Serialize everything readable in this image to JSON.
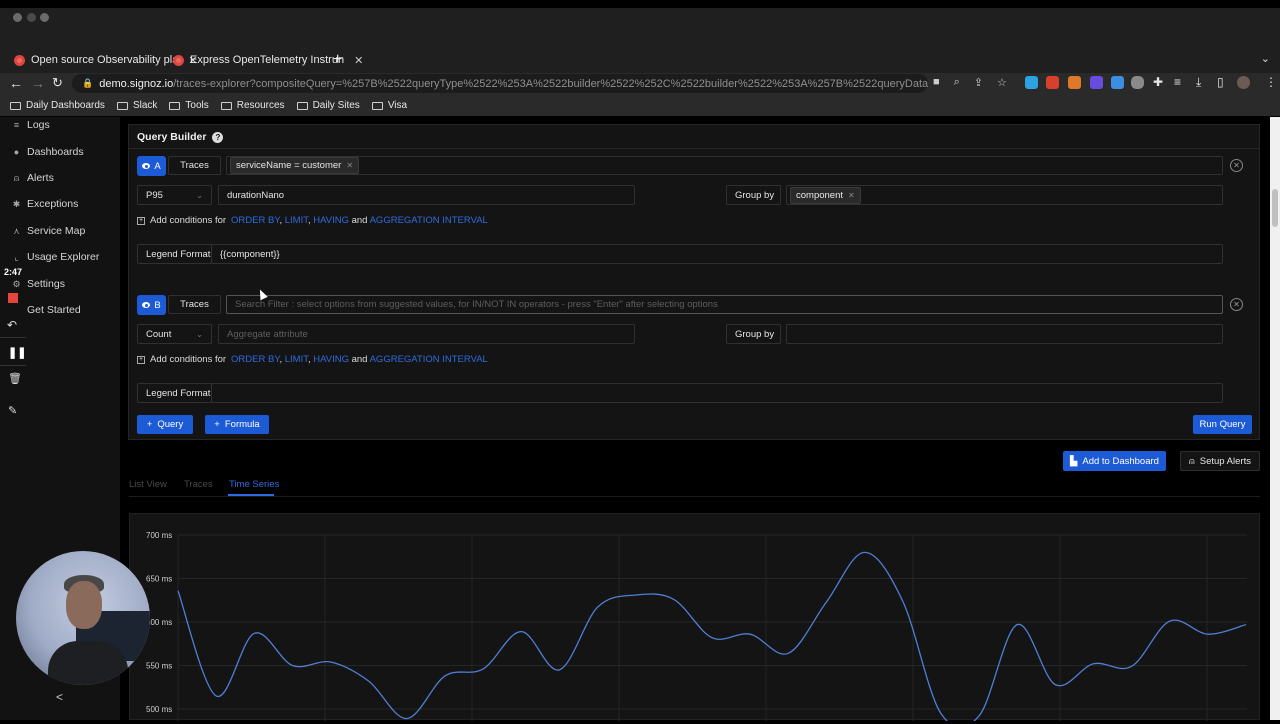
{
  "browser": {
    "tabs": [
      {
        "title": "Open source Observability pla",
        "active": true
      },
      {
        "title": "Express OpenTelemetry Instrun",
        "active": false
      }
    ],
    "new_tab": "+",
    "address": {
      "host": "demo.signoz.io",
      "path": "/traces-explorer?compositeQuery=%257B%2522queryType%2522%253A%2522builder%2522%252C%2522builder%2522%253A%257B%2522queryData%2522%253A%..."
    },
    "bookmarks": [
      "Daily Dashboards",
      "Slack",
      "Tools",
      "Resources",
      "Daily Sites",
      "Visa"
    ]
  },
  "sidebar": {
    "items": [
      {
        "label": "Logs",
        "icon": "logs-icon"
      },
      {
        "label": "Dashboards",
        "icon": "dashboard-icon"
      },
      {
        "label": "Alerts",
        "icon": "alert-icon"
      },
      {
        "label": "Exceptions",
        "icon": "bug-icon"
      },
      {
        "label": "Service Map",
        "icon": "service-map-icon"
      },
      {
        "label": "Usage Explorer",
        "icon": "chart-icon"
      },
      {
        "label": "Settings",
        "icon": "settings-icon"
      },
      {
        "label": "Get Started",
        "icon": "rocket-icon"
      }
    ],
    "recording_timer": "2:47",
    "collapse": "<"
  },
  "query_builder": {
    "title": "Query Builder",
    "help": "?",
    "queries": [
      {
        "name": "A",
        "data_source": "Traces",
        "filter_chip": "serviceName = customer",
        "filter_placeholder": "",
        "aggregate_op": "P95",
        "aggregate_attr": "durationNano",
        "aggregate_attr_placeholder": "",
        "group_by_label": "Group by",
        "group_by_chip": "component",
        "add_conditions_prefix": "Add conditions for",
        "legend_label": "Legend Format",
        "legend_value": "{{component}}"
      },
      {
        "name": "B",
        "data_source": "Traces",
        "filter_chip": "",
        "filter_placeholder": "Search Filter : select options from suggested values, for IN/NOT IN operators - press \"Enter\" after selecting options",
        "aggregate_op": "Count",
        "aggregate_attr": "",
        "aggregate_attr_placeholder": "Aggregate attribute",
        "group_by_label": "Group by",
        "group_by_chip": "",
        "add_conditions_prefix": "Add conditions for",
        "legend_label": "Legend Format",
        "legend_value": ""
      }
    ],
    "condition_links": [
      "ORDER BY",
      "LIMIT",
      "HAVING",
      "AGGREGATION INTERVAL"
    ],
    "and_word": "and",
    "add_query_button": "Query",
    "add_formula_button": "Formula",
    "run_query_button": "Run Query"
  },
  "actions": {
    "add_to_dashboard": "Add to Dashboard",
    "setup_alerts": "Setup Alerts"
  },
  "result_tabs": [
    {
      "label": "List View",
      "active": false
    },
    {
      "label": "Traces",
      "active": false
    },
    {
      "label": "Time Series",
      "active": true
    }
  ],
  "colors": {
    "accent": "#1d5bd6",
    "link": "#2e6be0",
    "series": "#4f7fd6",
    "background": "#141414"
  },
  "chart_data": {
    "type": "line",
    "title": "",
    "xlabel": "",
    "ylabel": "",
    "ylim": [
      500,
      700
    ],
    "yticks": [
      "700 ms",
      "650 ms",
      "600 ms",
      "550 ms",
      "500 ms"
    ],
    "ytick_values": [
      700,
      650,
      600,
      550,
      500
    ],
    "grid": true,
    "series": [
      {
        "name": "component",
        "x": [
          0,
          1,
          2,
          3,
          4,
          5,
          6,
          7,
          8,
          9,
          10,
          11,
          12,
          13,
          14,
          15,
          16,
          17,
          18,
          19,
          20,
          21,
          22,
          23,
          24,
          25,
          26,
          27,
          28
        ],
        "values": [
          636,
          515,
          587,
          550,
          554,
          532,
          489,
          538,
          546,
          589,
          545,
          617,
          631,
          626,
          582,
          586,
          564,
          623,
          680,
          624,
          495,
          492,
          597,
          528,
          552,
          549,
          601,
          586,
          597
        ]
      }
    ]
  }
}
